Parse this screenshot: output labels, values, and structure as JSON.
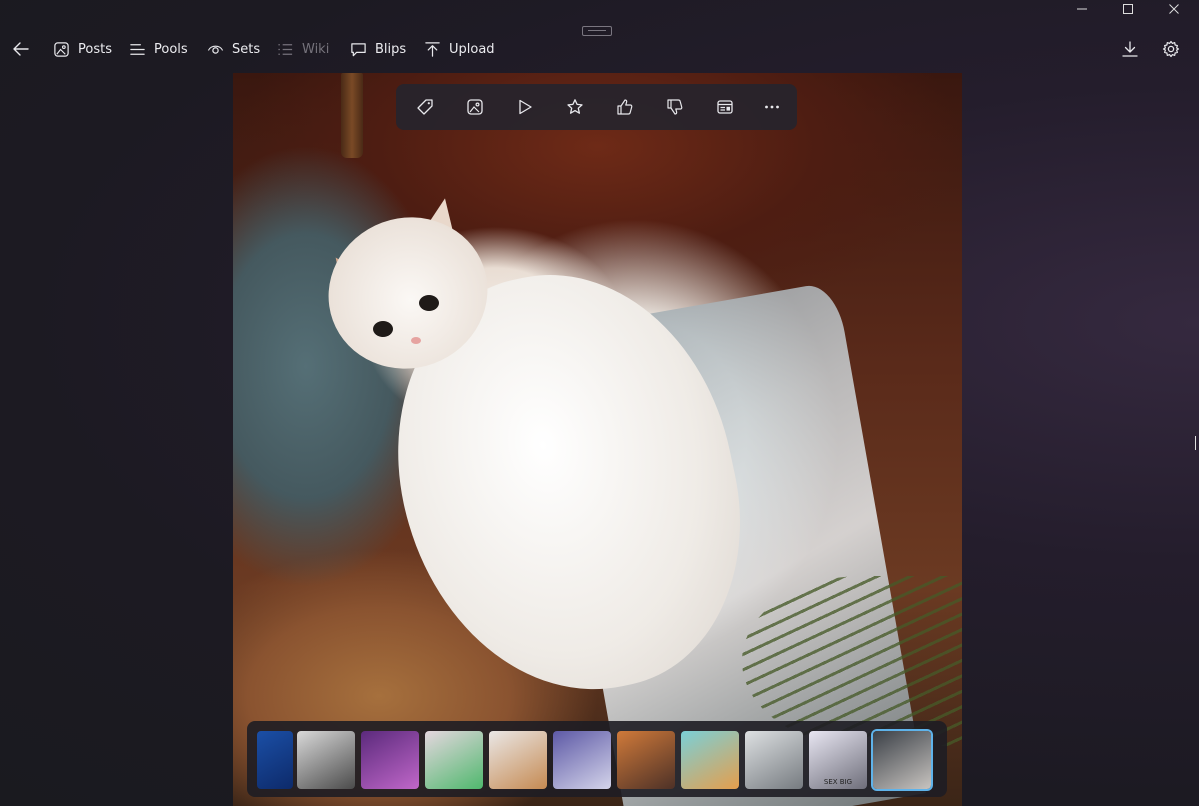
{
  "window": {
    "controls": [
      {
        "name": "minimize-icon",
        "glyph": "—"
      },
      {
        "name": "maximize-icon",
        "glyph": "☐"
      },
      {
        "name": "close-icon",
        "glyph": "✕"
      }
    ]
  },
  "nav": {
    "back_icon": "arrow-left-icon",
    "items": [
      {
        "label": "Posts",
        "icon": "image-icon",
        "enabled": true
      },
      {
        "label": "Pools",
        "icon": "list-lines-icon",
        "enabled": true
      },
      {
        "label": "Sets",
        "icon": "eye-icon",
        "enabled": true
      },
      {
        "label": "Wiki",
        "icon": "bulleted-list-icon",
        "enabled": false
      },
      {
        "label": "Blips",
        "icon": "speech-bubble-icon",
        "enabled": true
      },
      {
        "label": "Upload",
        "icon": "arrow-up-icon",
        "enabled": true
      }
    ],
    "download_icon": "download-icon",
    "settings_icon": "gear-icon"
  },
  "toolbar": {
    "buttons": [
      {
        "name": "tag-icon"
      },
      {
        "name": "picture-icon"
      },
      {
        "name": "play-icon"
      },
      {
        "name": "star-icon"
      },
      {
        "name": "thumbs-up-icon"
      },
      {
        "name": "thumbs-down-icon"
      },
      {
        "name": "details-icon"
      },
      {
        "name": "more-icon"
      }
    ]
  },
  "image": {
    "description_icon": "crying-cat-painting"
  },
  "thumbnails": {
    "items": [
      {
        "colors": [
          "#1b4fa6",
          "#0d2a6a"
        ],
        "text": ""
      },
      {
        "colors": [
          "#d9d9d9",
          "#4b4b4b"
        ],
        "text": ""
      },
      {
        "colors": [
          "#5b2a7c",
          "#c067c9"
        ],
        "text": ""
      },
      {
        "colors": [
          "#e5d7df",
          "#4fb86d"
        ],
        "text": ""
      },
      {
        "colors": [
          "#eae7e6",
          "#c58a52"
        ],
        "text": ""
      },
      {
        "colors": [
          "#5d59a6",
          "#d4d4ea"
        ],
        "text": ""
      },
      {
        "colors": [
          "#d07a3a",
          "#4d3127"
        ],
        "text": ""
      },
      {
        "colors": [
          "#7ad0d8",
          "#e59e4c"
        ],
        "text": ""
      },
      {
        "colors": [
          "#dde0e2",
          "#767b80"
        ],
        "text": ""
      },
      {
        "colors": [
          "#e8e6f2",
          "#6e6e7a"
        ],
        "text": "SEX BIG"
      },
      {
        "colors": [
          "#3a3f46",
          "#c8c4c0"
        ],
        "text": ""
      }
    ],
    "selected_index": 10
  }
}
